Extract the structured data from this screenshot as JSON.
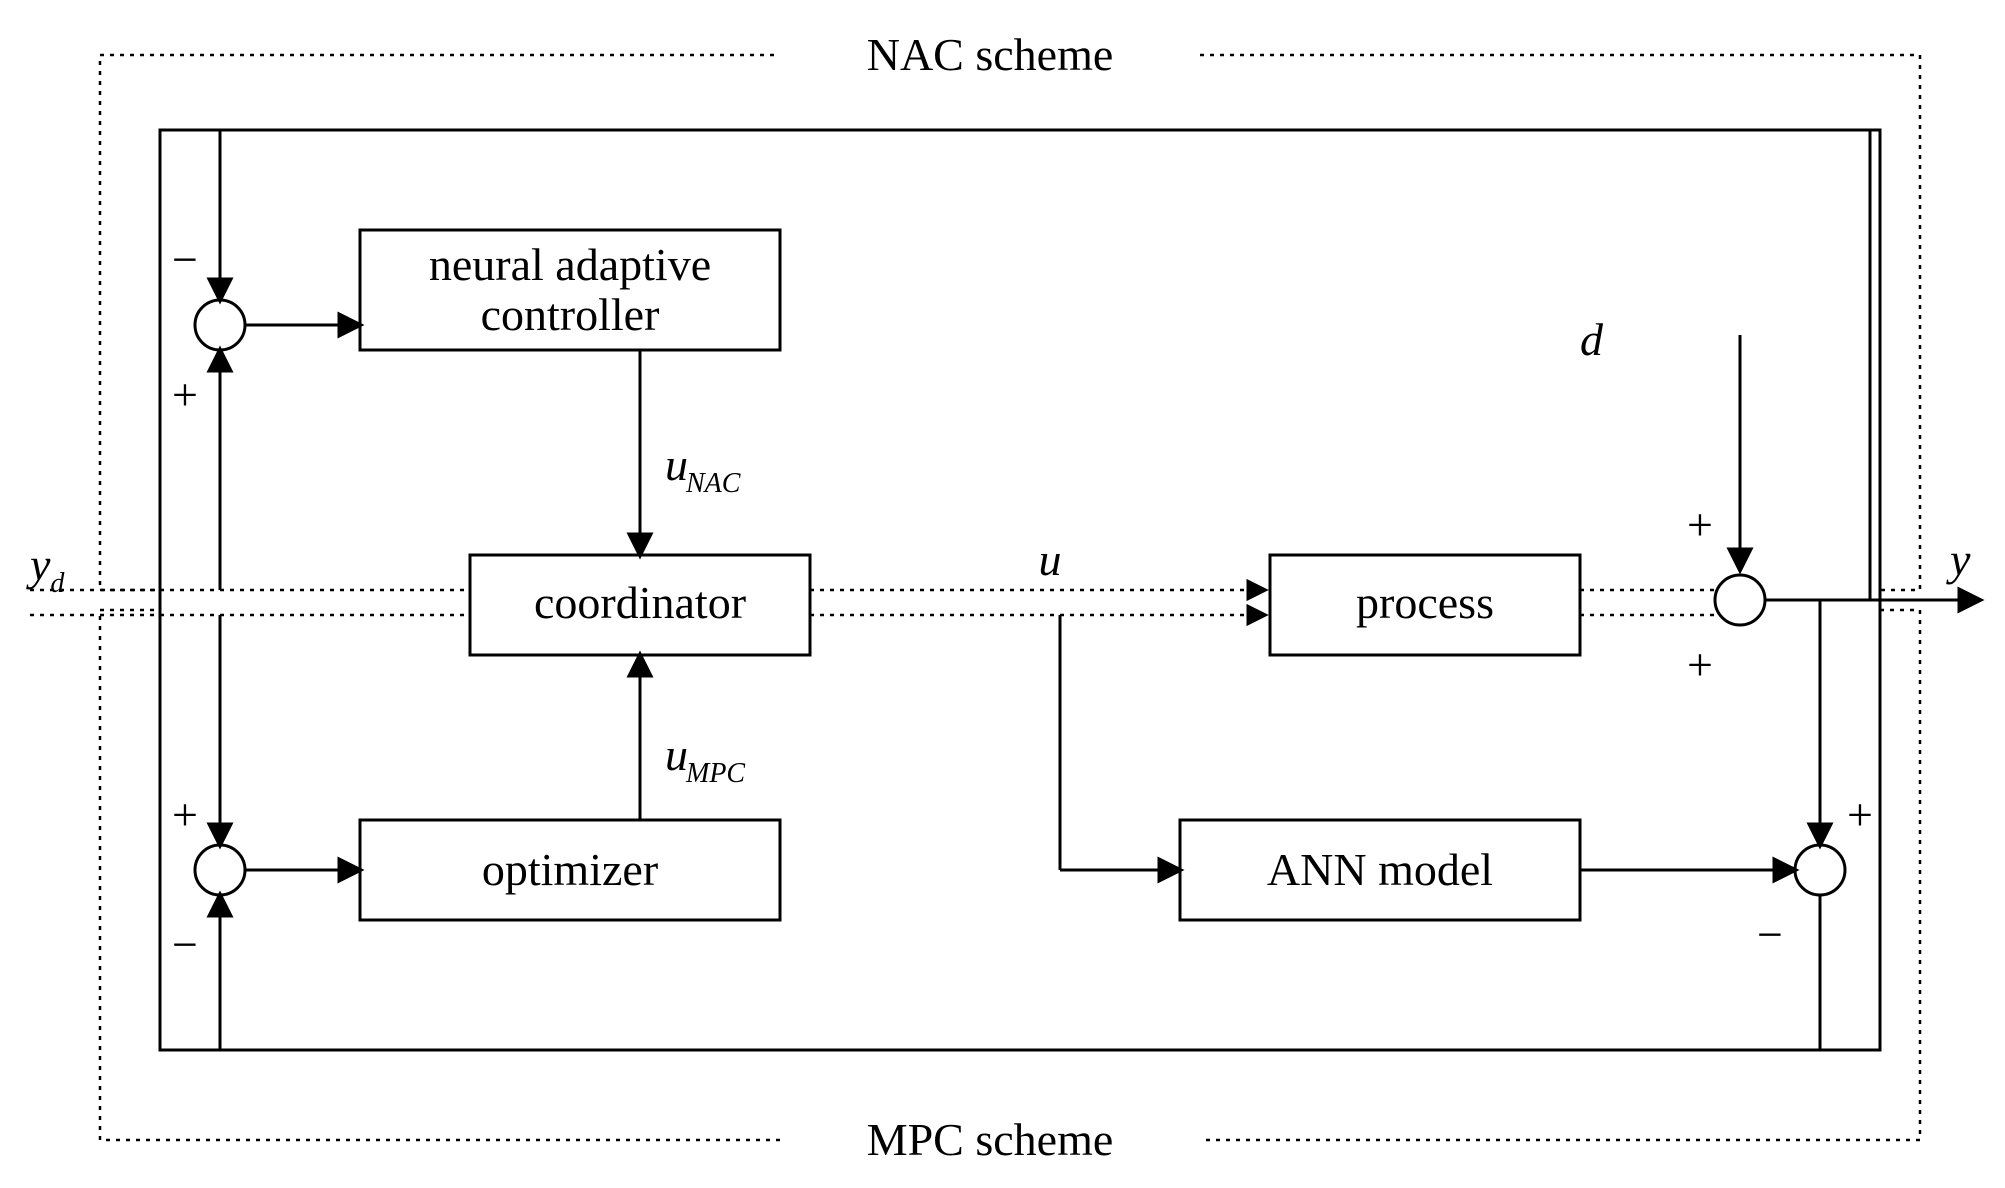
{
  "titles": {
    "nac": "NAC scheme",
    "mpc": "MPC scheme"
  },
  "blocks": {
    "nac_ctrl_l1": "neural adaptive",
    "nac_ctrl_l2": "controller",
    "coordinator": "coordinator",
    "optimizer": "optimizer",
    "process": "process",
    "ann_model": "ANN model"
  },
  "signals": {
    "yd": "y",
    "yd_sub": "d",
    "u": "u",
    "u_nac": "u",
    "u_nac_sub": "NAC",
    "u_mpc": "u",
    "u_mpc_sub": "MPC",
    "d": "d",
    "y": "y"
  },
  "signs": {
    "nac_sum_top": "−",
    "nac_sum_bot": "+",
    "mpc_sum_top": "+",
    "mpc_sum_bot": "−",
    "disturb_top": "+",
    "disturb_bot": "+",
    "model_sum_top": "+",
    "model_sum_bot": "−"
  }
}
